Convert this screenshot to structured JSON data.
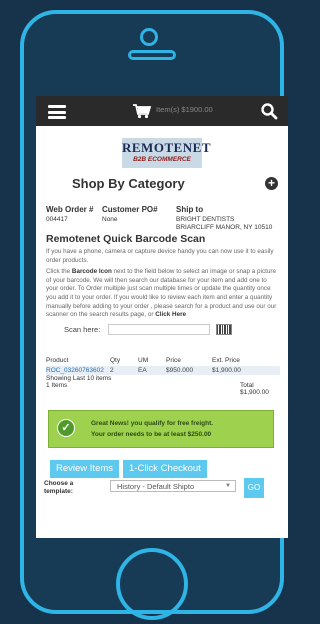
{
  "header": {
    "cart_text": "Item(s) $1900.00"
  },
  "logo": {
    "title": "REMOTENET",
    "subtitle": "B2B ECOMMERCE"
  },
  "shop_by_category": "Shop By Category",
  "order": {
    "web_order_label": "Web Order #",
    "customer_po_label": "Customer PO#",
    "ship_to_label": "Ship to",
    "web_order_value": "004417",
    "customer_po_value": "None",
    "ship_name": "BRIGHT DENTISTS",
    "ship_addr": "BRIARCLIFF MANOR, NY 10510"
  },
  "quick_scan": {
    "title": "Remotenet Quick Barcode Scan",
    "p1": "If you have a phone, camera or capture device handy you can now use it to easily order products.",
    "p2a": "Click the ",
    "p2b": "Barcode Icon",
    "p2c": " next to the field below to select an image or snap a picture of your barcode. We will then search our database for your item and add one to your order. To Order multiple just scan multiple times or update the quantity once you add it to your order. If you would like to review each item and enter a quantity manually before adding to your order , please search for a product and use our our scanner on the search results page, or ",
    "p2d": "Click Here",
    "scan_label": "Scan here:"
  },
  "items_table": {
    "headers": [
      "Product",
      "Qty",
      "UM",
      "Price",
      "Ext. Price"
    ],
    "rows": [
      [
        "ROC_03260763602",
        "2",
        "EA",
        "$950.000",
        "$1,900.00"
      ]
    ],
    "showing": "Showing Last 10 items",
    "count": "1 Items",
    "total_label": "Total",
    "total_value": "$1,900.00"
  },
  "freight": {
    "line1": "Great News! you qualify for free freight.",
    "line2": "Your order needs to be at least $250.00"
  },
  "buttons": {
    "review": "Review Items",
    "checkout": "1-Click Checkout"
  },
  "template": {
    "label": "Choose a template:",
    "selected": "History - Default Shipto",
    "go": "GO"
  }
}
